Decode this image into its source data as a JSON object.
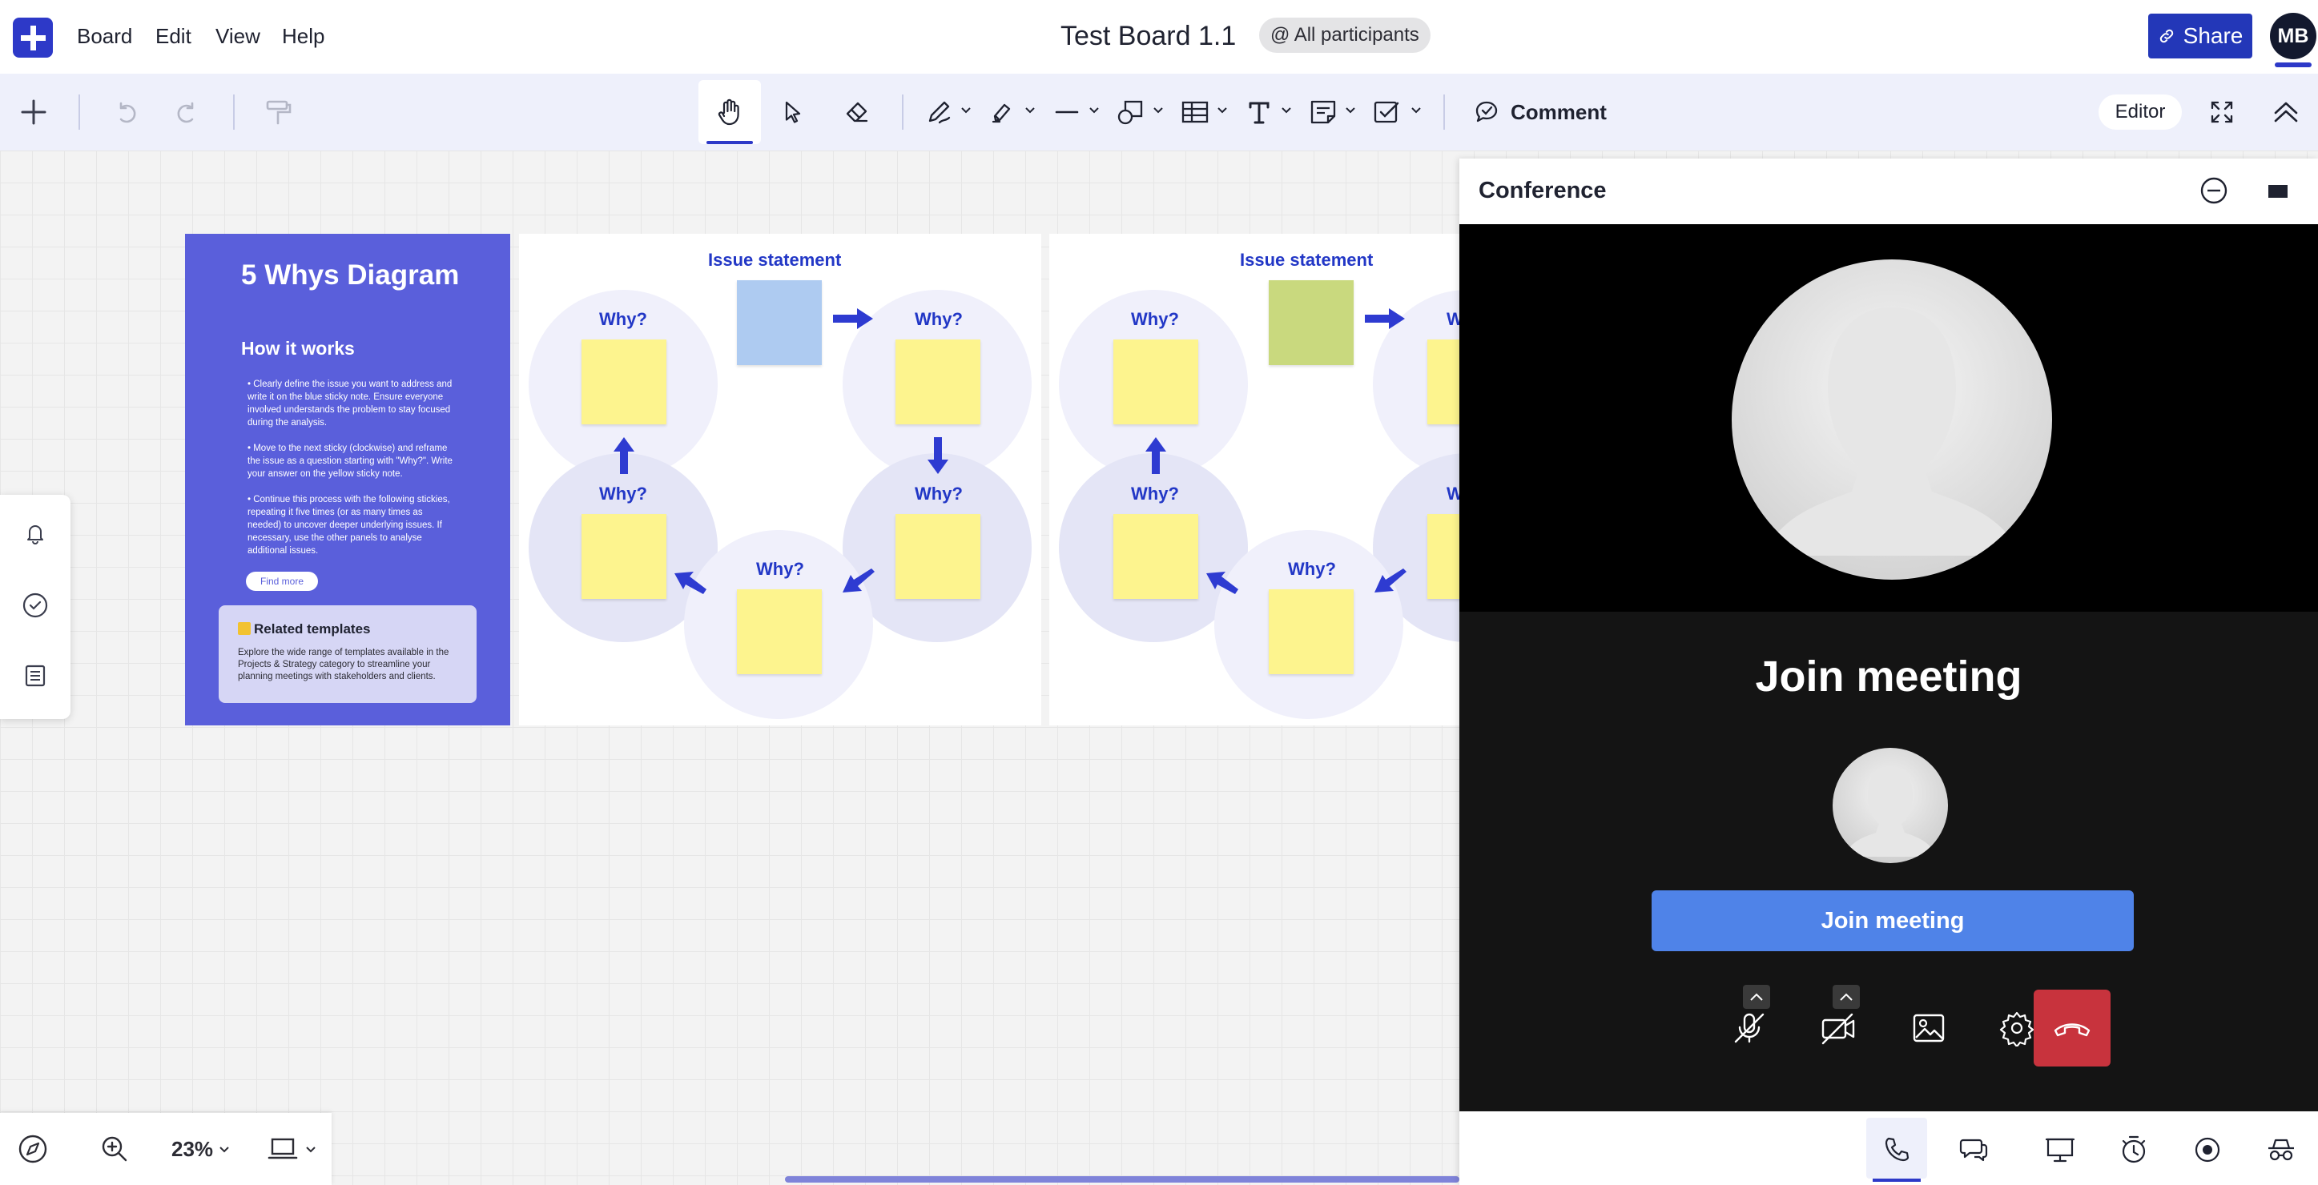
{
  "app": {
    "menu": [
      "Board",
      "Edit",
      "View",
      "Help"
    ],
    "board_title": "Test Board 1.1",
    "participants": "@ All participants",
    "share_label": "Share",
    "user_initials": "MB"
  },
  "toolbar": {
    "comment_label": "Comment",
    "mode_label": "Editor",
    "active_tool": "hand"
  },
  "template": {
    "title": "5 Whys Diagram",
    "subtitle": "How it works",
    "steps": [
      "• Clearly define the issue you want to address and write it on the blue sticky note. Ensure everyone involved understands the problem to stay focused during the analysis.",
      "• Move to the next sticky (clockwise) and reframe the issue as a question starting with \"Why?\". Write your answer on the yellow sticky note.",
      "• Continue this process with the following stickies, repeating it five times (or as many times as needed) to uncover deeper underlying issues. If necessary, use the other panels to analyse additional issues."
    ],
    "find_more": "Find more",
    "related_title": "Related templates",
    "related_body": "Explore the wide range of templates available in the Projects & Strategy category to streamline your planning meetings with stakeholders and clients."
  },
  "diagrams": [
    {
      "issue_label": "Issue statement",
      "issue_color": "#aecbf1",
      "why_labels": [
        "Why?",
        "Why?",
        "Why?",
        "Why?",
        "Why?"
      ]
    },
    {
      "issue_label": "Issue statement",
      "issue_color": "#c9d97e",
      "why_labels": [
        "Why?",
        "Why?",
        "Why?",
        "Why?",
        "Why?"
      ]
    }
  ],
  "conference": {
    "title": "Conference",
    "join_title": "Join meeting",
    "join_button": "Join meeting"
  },
  "navigation": {
    "zoom": "23%"
  },
  "colors": {
    "brand": "#2d39c8",
    "template_panel": "#5a5fdb",
    "sticky_yellow": "#fdf48e",
    "arrow_blue": "#2e3bd1",
    "join_button": "#4f83e8",
    "hangup": "#c8333d"
  }
}
